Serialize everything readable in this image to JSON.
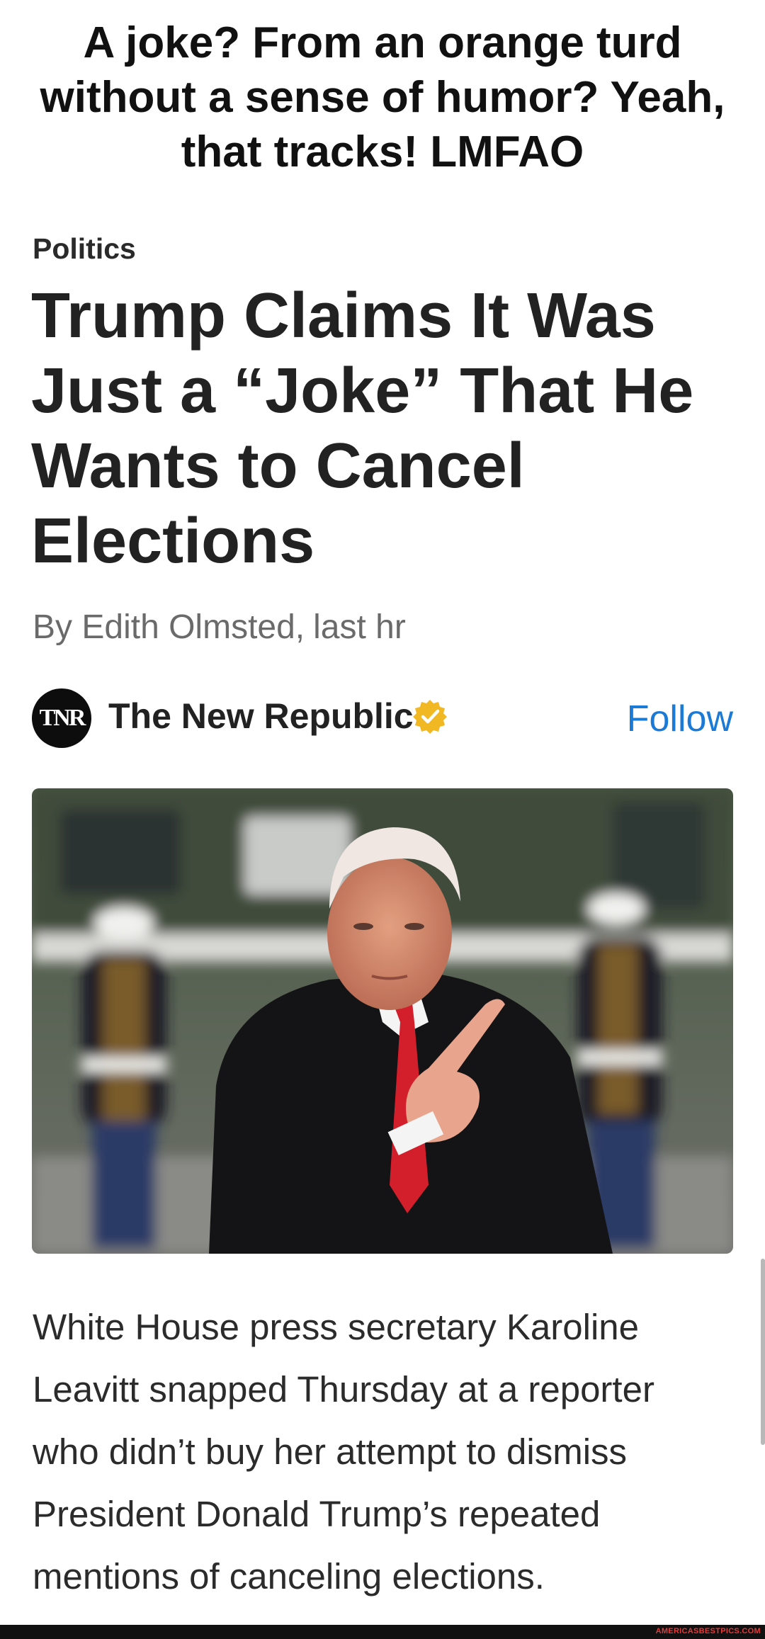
{
  "caption": {
    "lines": [
      "A joke? From an orange turd",
      "without a sense of humor? Yeah,",
      "that tracks! LMFAO"
    ]
  },
  "article": {
    "category": "Politics",
    "headline_lines": [
      "Trump Claims It Was",
      "Just a “Joke” That He",
      "Wants to Cancel",
      "Elections"
    ],
    "author": "By Edith Olmsted,",
    "time": "last hr",
    "body_lines": [
      "White House press secretary Karoline",
      "Leavitt snapped Thursday at a reporter",
      "who didn’t buy her attempt to dismiss",
      "President Donald Trump’s repeated",
      "mentions of canceling elections."
    ]
  },
  "publisher": {
    "name": "The New Republic",
    "logo_text": "TNR",
    "verified_icon": "verified-badge-icon",
    "follow_label": "Follow"
  },
  "image": {
    "subject": "article-photo"
  },
  "watermark": "AMERICASBESTPICS.COM",
  "colors": {
    "follow": "#1a7ad6",
    "verified": "#f2b823",
    "watermark": "#e23b3b"
  }
}
